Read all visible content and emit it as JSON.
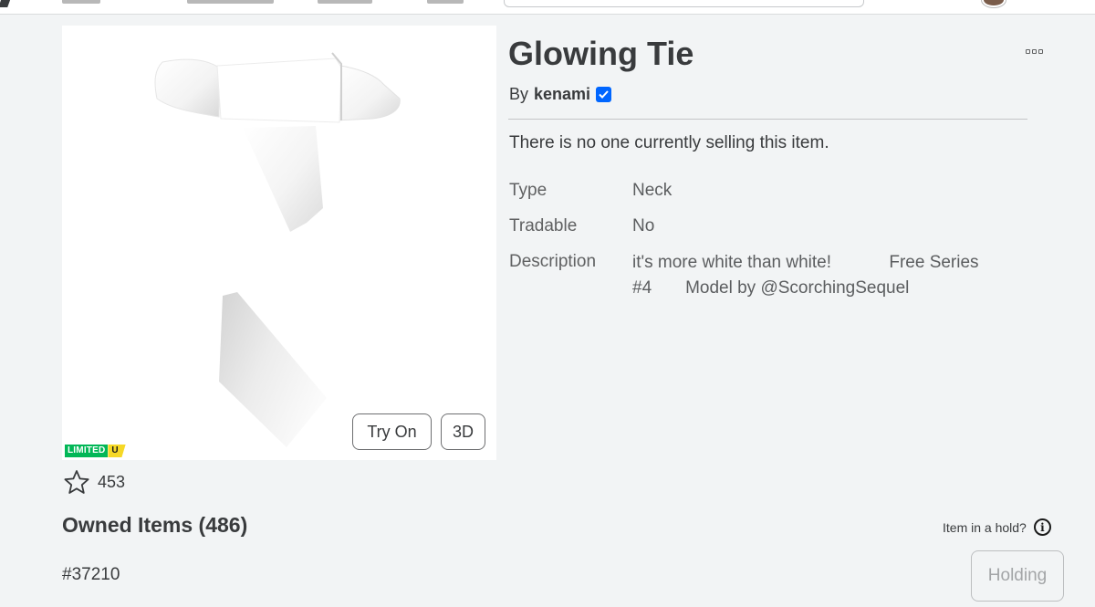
{
  "item": {
    "title": "Glowing Tie",
    "by_label": "By",
    "creator": "kenami",
    "seller_status": "There is no one currently selling this item.",
    "details": [
      {
        "label": "Type",
        "value": "Neck"
      },
      {
        "label": "Tradable",
        "value": "No"
      },
      {
        "label": "Description",
        "lines": [
          "it's more white than white!            Free Series",
          "#4       Model by @ScorchingSequel"
        ]
      }
    ],
    "favorites": "453",
    "badge": {
      "limited": "LIMITED",
      "unique": "U"
    }
  },
  "thumbnail": {
    "try_on_label": "Try On",
    "view3d_label": "3D"
  },
  "owned": {
    "title": "Owned Items (486)",
    "serial": "#37210",
    "hold_question": "Item in a hold?",
    "holding_label": "Holding"
  },
  "icons": {
    "verified": "verified-badge-icon",
    "star": "star-outline-icon",
    "more": "more-options-icon",
    "info": "info-icon"
  },
  "colors": {
    "verified": "#0066ff",
    "limited_green": "#02b757",
    "unique_yellow": "#f6d826",
    "page_bg": "#f2f4f5"
  }
}
